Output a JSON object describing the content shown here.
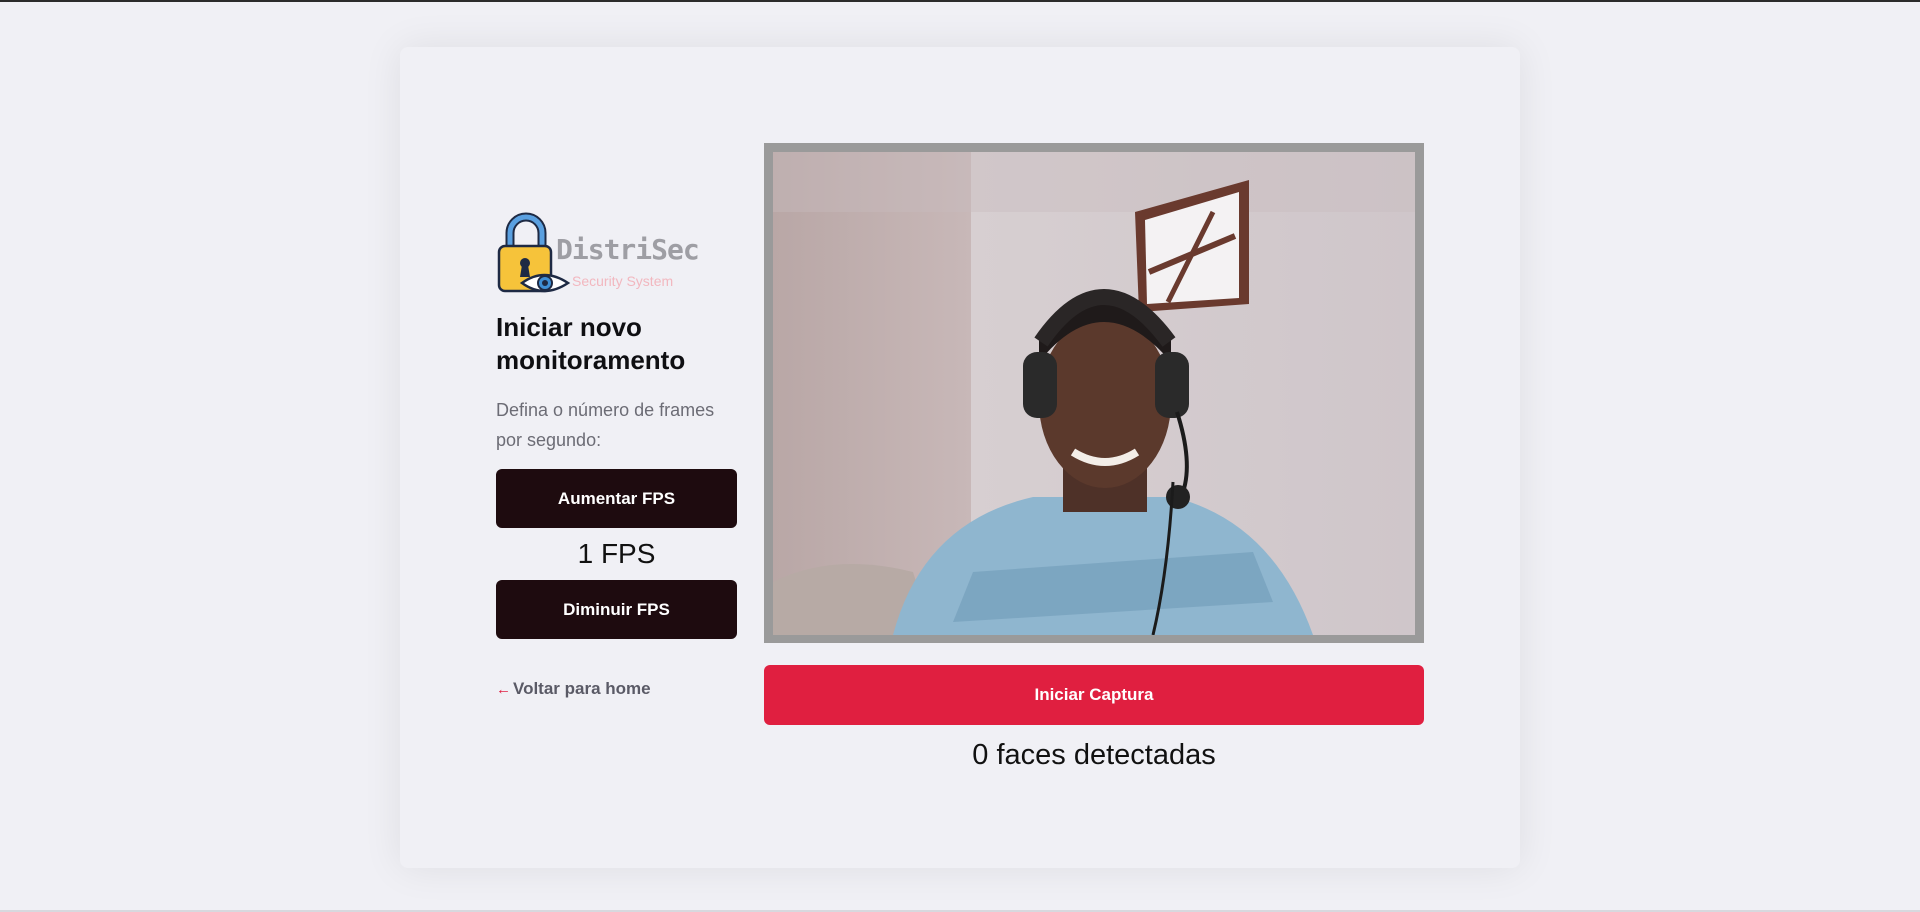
{
  "logo": {
    "brand": "DistriSec",
    "tagline": "Security System",
    "icon": "lock-eye-icon"
  },
  "panel": {
    "title": "Iniciar novo monitoramento",
    "subtitle": "Defina o número de frames por segundo:",
    "increase_label": "Aumentar FPS",
    "fps_value": "1 FPS",
    "decrease_label": "Diminuir FPS",
    "back_label": "Voltar para home",
    "back_icon": "arrow-left-icon"
  },
  "capture": {
    "button_label": "Iniciar Captura",
    "faces_text": "0 faces detectadas"
  },
  "colors": {
    "dark_button": "#1e0b0f",
    "accent_red": "#e01f40",
    "background": "#f0f0f5"
  }
}
